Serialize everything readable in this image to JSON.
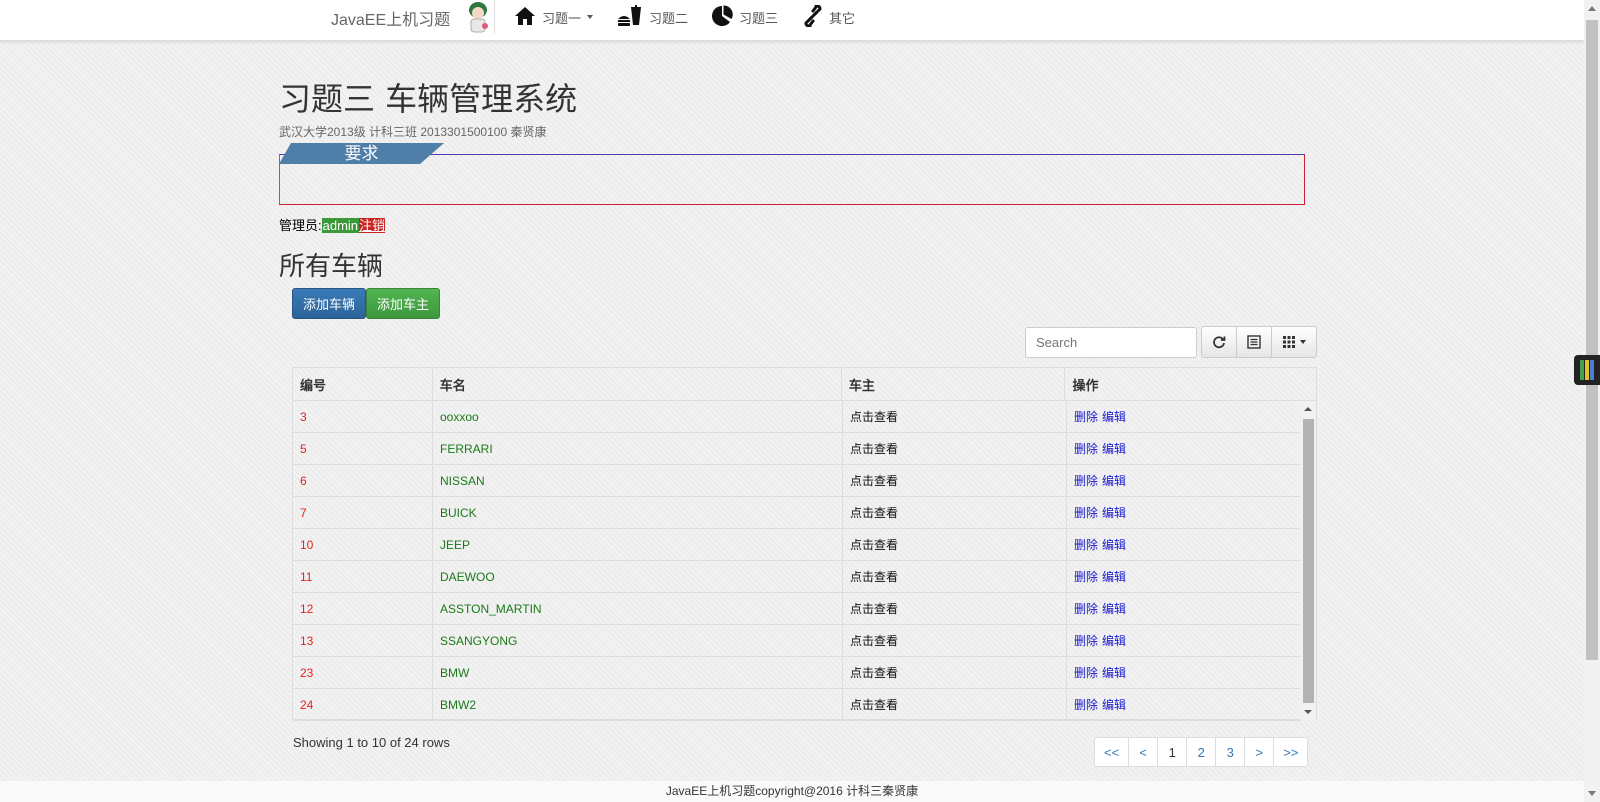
{
  "navbar": {
    "brand": "JavaEE上机习题",
    "items": [
      {
        "label": "习题一",
        "icon": "home-icon",
        "dropdown": true
      },
      {
        "label": "习题二",
        "icon": "food-icon"
      },
      {
        "label": "习题三",
        "icon": "pie-chart-icon"
      },
      {
        "label": "其它",
        "icon": "link-icon"
      }
    ]
  },
  "header": {
    "title": "习题三 车辆管理系统",
    "subtitle": "武汉大学2013级 计科三班 2013301500100 秦贤康",
    "requirements_label": "要求"
  },
  "admin": {
    "prefix": "管理员:",
    "name": "admin",
    "logout": "注销"
  },
  "section": {
    "title": "所有车辆",
    "add_car": "添加车辆",
    "add_owner": "添加车主"
  },
  "toolbar": {
    "search_placeholder": "Search",
    "refresh_icon": "refresh-icon",
    "toggle_icon": "list-icon",
    "columns_icon": "grid-icon"
  },
  "table": {
    "headers": [
      "编号",
      "车名",
      "车主",
      "操作"
    ],
    "rows": [
      {
        "id": "3",
        "name": "ooxxoo",
        "owner": "点击查看",
        "delete": "删除",
        "edit": "编辑"
      },
      {
        "id": "5",
        "name": "FERRARI",
        "owner": "点击查看",
        "delete": "删除",
        "edit": "编辑"
      },
      {
        "id": "6",
        "name": "NISSAN",
        "owner": "点击查看",
        "delete": "删除",
        "edit": "编辑"
      },
      {
        "id": "7",
        "name": "BUICK",
        "owner": "点击查看",
        "delete": "删除",
        "edit": "编辑"
      },
      {
        "id": "10",
        "name": "JEEP",
        "owner": "点击查看",
        "delete": "删除",
        "edit": "编辑"
      },
      {
        "id": "11",
        "name": "DAEWOO",
        "owner": "点击查看",
        "delete": "删除",
        "edit": "编辑"
      },
      {
        "id": "12",
        "name": "ASSTON_MARTIN",
        "owner": "点击查看",
        "delete": "删除",
        "edit": "编辑"
      },
      {
        "id": "13",
        "name": "SSANGYONG",
        "owner": "点击查看",
        "delete": "删除",
        "edit": "编辑"
      },
      {
        "id": "23",
        "name": "BMW",
        "owner": "点击查看",
        "delete": "删除",
        "edit": "编辑"
      },
      {
        "id": "24",
        "name": "BMW2",
        "owner": "点击查看",
        "delete": "删除",
        "edit": "编辑"
      }
    ]
  },
  "pagination": {
    "showing": "Showing 1 to 10 of 24 rows",
    "buttons": [
      "<<",
      "<",
      "1",
      "2",
      "3",
      ">",
      ">>"
    ],
    "active": "1"
  },
  "footer": {
    "text": "JavaEE上机习题copyright@2016 计科三秦贤康"
  },
  "colors": {
    "id_text": "#e52222",
    "name_text": "#1a7a1a",
    "action_link": "#1a1ad0",
    "primary_button": "#2d6399",
    "success_button": "#3d983d",
    "ribbon": "#4f7fa8"
  }
}
